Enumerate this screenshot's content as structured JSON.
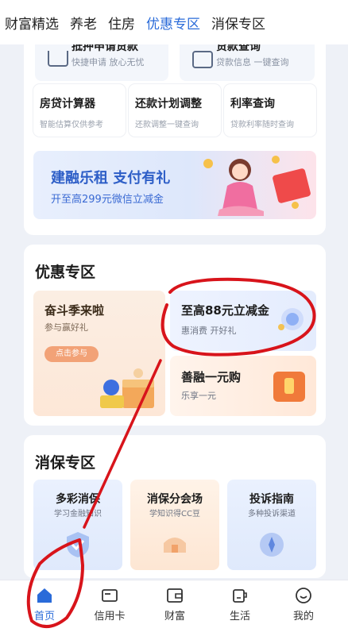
{
  "top_tabs": [
    "财富精选",
    "养老",
    "住房",
    "优惠专区",
    "消保专区"
  ],
  "top_tabs_active": "优惠专区",
  "housing": {
    "partial_items": [
      {
        "title_cut": "抵押申请贷款",
        "sub": "快捷申请 放心无忧"
      },
      {
        "title_cut": "贷款查询",
        "sub": "贷款信息 一键查询"
      }
    ],
    "tools": [
      {
        "title": "房贷计算器",
        "sub": "智能估算仅供参考"
      },
      {
        "title": "还款计划调整",
        "sub": "还款调整一键查询"
      },
      {
        "title": "利率查询",
        "sub": "贷款利率随时查询"
      }
    ],
    "banner": {
      "headline": "建融乐租 支付有礼",
      "sub": "开至高299元微信立减金"
    }
  },
  "promo": {
    "title": "优惠专区",
    "left": {
      "title": "奋斗季来啦",
      "sub": "参与赢好礼",
      "button": "点击参与"
    },
    "right_top": {
      "title": "至高88元立减金",
      "sub": "惠消费 开好礼"
    },
    "right_bottom": {
      "title": "善融一元购",
      "sub": "乐享一元"
    }
  },
  "consumer": {
    "title": "消保专区",
    "items": [
      {
        "title": "多彩消保",
        "sub": "学习金融知识"
      },
      {
        "title": "消保分会场",
        "sub": "学知识得CC豆"
      },
      {
        "title": "投诉指南",
        "sub": "多种投诉渠道"
      }
    ]
  },
  "bottom_nav": [
    "首页",
    "信用卡",
    "财富",
    "生活",
    "我的"
  ],
  "bottom_nav_active": "首页",
  "colors": {
    "accent": "#2a6bd9",
    "annotation_red": "#d8141b"
  }
}
